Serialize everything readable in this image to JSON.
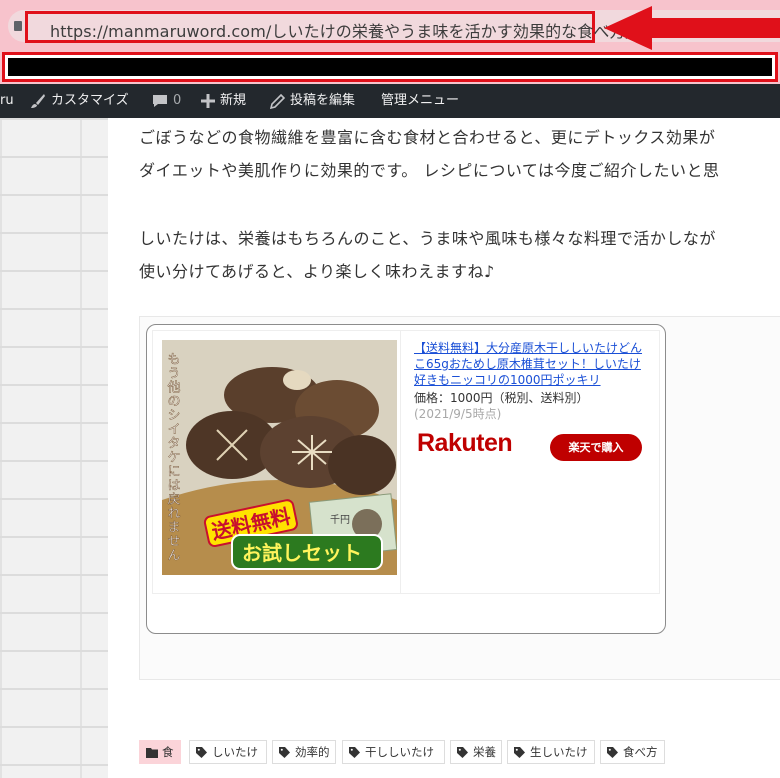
{
  "browser": {
    "url": "https://manmaruword.com/しいたけの栄養やうま味を活かす効果的な食べ方/"
  },
  "admin_bar": {
    "site_fragment": "ru",
    "customize": "カスタマイズ",
    "comments_count": "0",
    "new_label": "新規",
    "edit_post": "投稿を編集",
    "admin_menu": "管理メニュー"
  },
  "article": {
    "lines": [
      "ごぼうなどの食物繊維を豊富に含む食材と合わせると、更にデトックス効果が",
      "ダイエットや美肌作りに効果的です。 レシピについては今度ご紹介したいと思",
      "しいたけは、栄養はもちろんのこと、うま味や風味も様々な料理で活かしなが",
      "使い分けてあげると、より楽しく味わえますね♪"
    ]
  },
  "product": {
    "title": "【送料無料】大分産原木干ししいたけどんこ65gおためし原木椎茸セット！しいたけ好きもニッコリの1000円ポッキリ",
    "price": "価格：1000円（税別、送料別）",
    "date_note": "(2021/9/5時点)",
    "logo_text": "Rakuten",
    "buy_label": "楽天で購入",
    "image": {
      "vertical_text": "もう他のシイタケには戻れません",
      "badge_text": "送料無料",
      "banner_text": "お試しセット",
      "bill_text": "千円"
    }
  },
  "tags": {
    "category": "食",
    "items": [
      "しいたけ",
      "効率的",
      "干ししいたけ",
      "栄養",
      "生しいたけ",
      "食べ方"
    ]
  },
  "colors": {
    "annotation_red": "#e0101a",
    "rakuten_red": "#bf0000",
    "admin_bar": "#23282d",
    "link_blue": "#1a4fd6",
    "category_pink": "#fbd4d9"
  }
}
